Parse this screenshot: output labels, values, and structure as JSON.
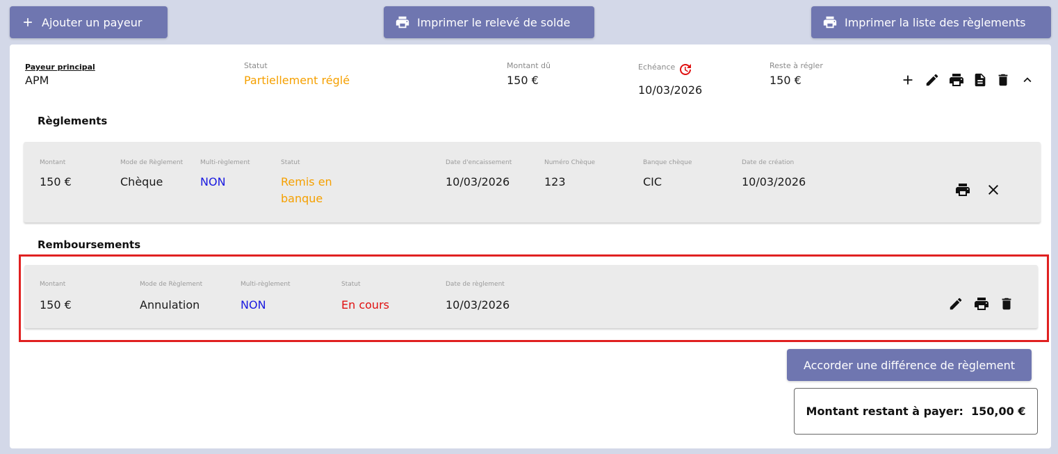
{
  "toolbar": {
    "add_payer_label": "Ajouter un payeur",
    "print_balance_label": "Imprimer le relevé de solde",
    "print_payments_label": "Imprimer la liste des règlements"
  },
  "payer": {
    "payer_label": "Payeur principal",
    "payer_value": "APM",
    "status_label": "Statut",
    "status_value": "Partiellement réglé",
    "amount_due_label": "Montant dû",
    "amount_due_value": "150 €",
    "due_label": "Echéance",
    "due_value": "10/03/2026",
    "remaining_label": "Reste à régler",
    "remaining_value": "150 €"
  },
  "payments": {
    "title": "Règlements",
    "headers": {
      "amount": "Montant",
      "mode": "Mode de Règlement",
      "multi": "Multi-règlement",
      "status": "Statut",
      "cash_date": "Date d'encaissement",
      "check_number": "Numéro Chèque",
      "bank": "Banque chèque",
      "created": "Date de création"
    },
    "row": {
      "amount": "150 €",
      "mode": "Chèque",
      "multi": "NON",
      "status_line1": "Remis en",
      "status_line2": "banque",
      "cash_date": "10/03/2026",
      "check_number": "123",
      "bank": "CIC",
      "created": "10/03/2026"
    }
  },
  "refunds": {
    "title": "Remboursements",
    "headers": {
      "amount": "Montant",
      "mode": "Mode de Règlement",
      "multi": "Multi-règlement",
      "status": "Statut",
      "date": "Date de règlement"
    },
    "row": {
      "amount": "150 €",
      "mode": "Annulation",
      "multi": "NON",
      "status": "En cours",
      "date": "10/03/2026"
    }
  },
  "footer": {
    "diff_button_label": "Accorder une différence de règlement",
    "remaining_text": "Montant restant à payer:  150,00 €"
  },
  "colors": {
    "primary_button": "#6f76b0",
    "status_orange": "#f5a000",
    "status_red": "#e01010",
    "multi_blue": "#1a1ae0",
    "highlight_red": "#e02020"
  }
}
